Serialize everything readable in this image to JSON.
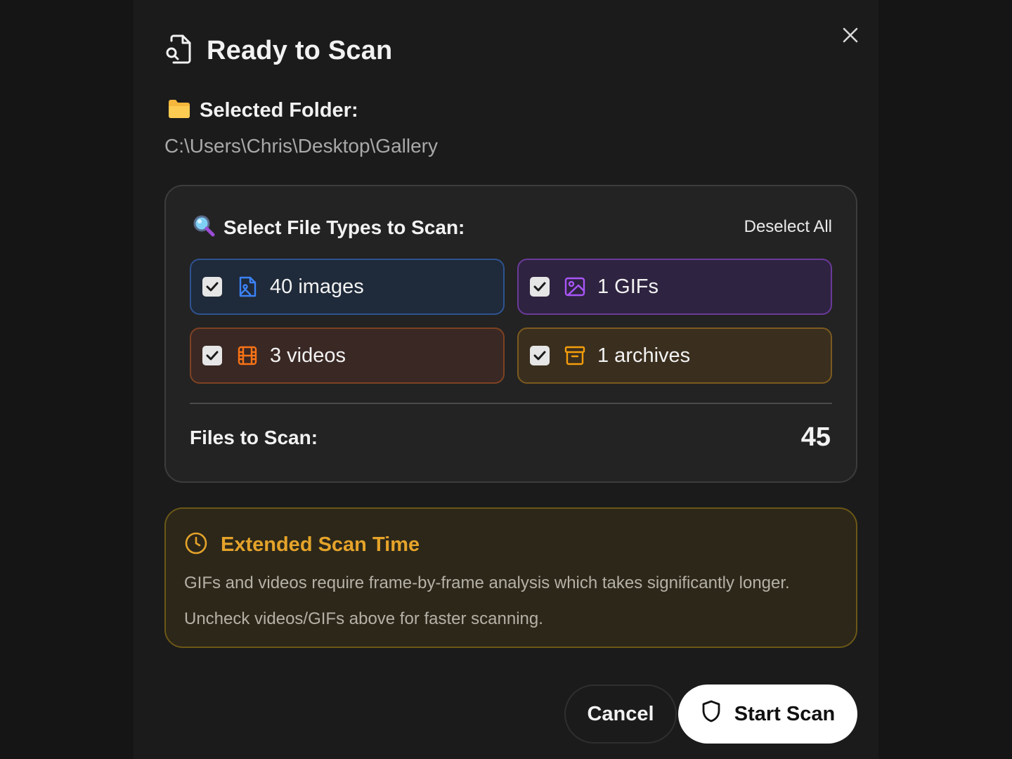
{
  "dialog": {
    "title": "Ready to Scan",
    "close_icon": "close-icon",
    "folder_label": "Selected Folder:",
    "folder_path": "C:\\Users\\Chris\\Desktop\\Gallery"
  },
  "file_types": {
    "heading": "Select File Types to Scan:",
    "deselect_all": "Deselect All",
    "items": [
      {
        "label": "40 images",
        "checked": true,
        "icon": "image-file-icon",
        "color": "#3b82f6"
      },
      {
        "label": "1 GIFs",
        "checked": true,
        "icon": "image-icon",
        "color": "#a855f7"
      },
      {
        "label": "3 videos",
        "checked": true,
        "icon": "film-icon",
        "color": "#f97316"
      },
      {
        "label": "1 archives",
        "checked": true,
        "icon": "archive-icon",
        "color": "#f59e0b"
      }
    ],
    "files_to_scan_label": "Files to Scan:",
    "files_to_scan_count": "45"
  },
  "warning": {
    "title": "Extended Scan Time",
    "line1": "GIFs and videos require frame-by-frame analysis which takes significantly longer.",
    "line2": "Uncheck videos/GIFs above for faster scanning.",
    "color": "#e5a32a"
  },
  "actions": {
    "cancel": "Cancel",
    "start": "Start Scan"
  }
}
